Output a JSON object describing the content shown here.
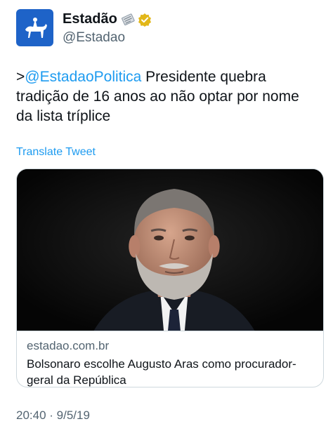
{
  "account": {
    "display_name": "Estadão",
    "handle": "@Estadao",
    "avatar_icon": "horse-rider-logo-icon",
    "label_icon": "newspaper-icon",
    "verified_icon": "gold-verified-badge-icon",
    "colors": {
      "avatar_bg": "#1e63c8",
      "verified": "#e2b719"
    }
  },
  "tweet": {
    "prefix": ">",
    "mention": "@EstadaoPolitica",
    "text": " Presidente quebra tradição de 16 anos ao não optar por nome da lista tríplice",
    "translate_label": "Translate Tweet",
    "timestamp": "20:40 · 9/5/19"
  },
  "card": {
    "image_icon": "man-portrait-photo",
    "domain": "estadao.com.br",
    "title": "Bolsonaro escolhe Augusto Aras como procurador-geral da República"
  },
  "colors": {
    "link": "#1d9bf0",
    "secondary_text": "#536471",
    "border": "#cfd9de"
  }
}
